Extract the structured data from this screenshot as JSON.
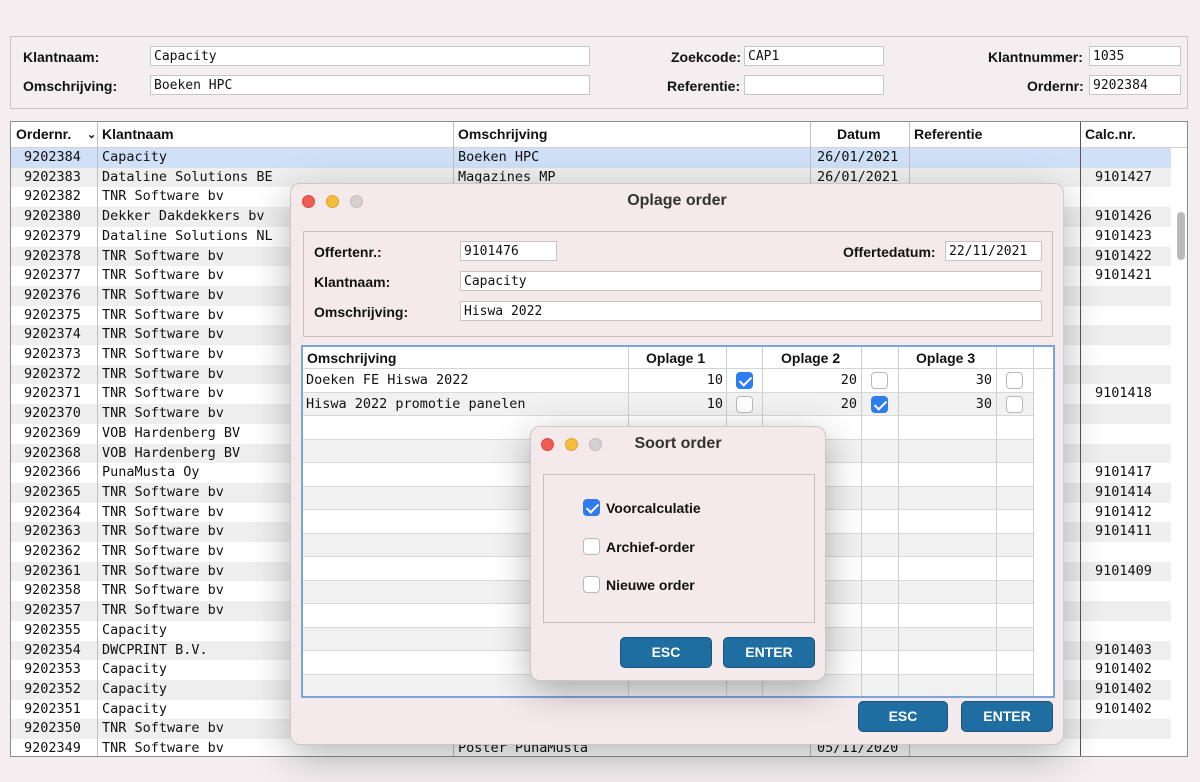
{
  "header": {
    "klantnaam_label": "Klantnaam:",
    "klantnaam_value": "Capacity",
    "omschrijving_label": "Omschrijving:",
    "omschrijving_value": "Boeken HPC",
    "zoekcode_label": "Zoekcode:",
    "zoekcode_value": "CAP1",
    "referentie_label": "Referentie:",
    "referentie_value": "",
    "klantnummer_label": "Klantnummer:",
    "klantnummer_value": "1035",
    "ordernr_label": "Ordernr:",
    "ordernr_value": "9202384"
  },
  "list": {
    "columns": [
      "Ordernr.",
      "Klantnaam",
      "Omschrijving",
      "Datum",
      "Referentie",
      "Calc.nr."
    ],
    "sort_icon": "chevron-down-icon",
    "rows": [
      [
        "9202384",
        "Capacity",
        "Boeken HPC",
        "26/01/2021",
        "",
        ""
      ],
      [
        "9202383",
        "Dataline Solutions BE",
        "Magazines MP",
        "26/01/2021",
        "",
        "9101427"
      ],
      [
        "9202382",
        "TNR Software bv",
        "",
        "",
        "",
        ""
      ],
      [
        "9202380",
        "Dekker Dakdekkers bv",
        "",
        "",
        "",
        "9101426"
      ],
      [
        "9202379",
        "Dataline Solutions NL",
        "",
        "",
        "",
        "9101423"
      ],
      [
        "9202378",
        "TNR Software bv",
        "",
        "",
        "",
        "9101422"
      ],
      [
        "9202377",
        "TNR Software bv",
        "",
        "",
        "",
        "9101421"
      ],
      [
        "9202376",
        "TNR Software bv",
        "",
        "",
        "",
        ""
      ],
      [
        "9202375",
        "TNR Software bv",
        "",
        "",
        "",
        ""
      ],
      [
        "9202374",
        "TNR Software bv",
        "",
        "",
        "",
        ""
      ],
      [
        "9202373",
        "TNR Software bv",
        "",
        "",
        "",
        ""
      ],
      [
        "9202372",
        "TNR Software bv",
        "",
        "",
        "",
        ""
      ],
      [
        "9202371",
        "TNR Software bv",
        "",
        "",
        "",
        "9101418"
      ],
      [
        "9202370",
        "TNR Software bv",
        "",
        "",
        "",
        ""
      ],
      [
        "9202369",
        "VOB Hardenberg BV",
        "",
        "",
        "",
        ""
      ],
      [
        "9202368",
        "VOB Hardenberg BV",
        "",
        "",
        "",
        ""
      ],
      [
        "9202366",
        "PunaMusta Oy",
        "",
        "",
        "",
        "9101417"
      ],
      [
        "9202365",
        "TNR Software bv",
        "",
        "",
        "",
        "9101414"
      ],
      [
        "9202364",
        "TNR Software bv",
        "",
        "",
        "",
        "9101412"
      ],
      [
        "9202363",
        "TNR Software bv",
        "",
        "",
        "",
        "9101411"
      ],
      [
        "9202362",
        "TNR Software bv",
        "",
        "",
        "",
        ""
      ],
      [
        "9202361",
        "TNR Software bv",
        "",
        "",
        "",
        "9101409"
      ],
      [
        "9202358",
        "TNR Software bv",
        "",
        "",
        "",
        ""
      ],
      [
        "9202357",
        "TNR Software bv",
        "",
        "",
        "",
        ""
      ],
      [
        "9202355",
        "Capacity",
        "",
        "",
        "",
        ""
      ],
      [
        "9202354",
        "DWCPRINT B.V.",
        "",
        "",
        "",
        "9101403"
      ],
      [
        "9202353",
        "Capacity",
        "",
        "",
        "",
        "9101402"
      ],
      [
        "9202352",
        "Capacity",
        "",
        "",
        "",
        "9101402"
      ],
      [
        "9202351",
        "Capacity",
        "",
        "",
        "",
        "9101402"
      ],
      [
        "9202350",
        "TNR Software bv",
        "",
        "",
        "",
        ""
      ],
      [
        "9202349",
        "TNR Software bv",
        "Poster PunaMusta",
        "05/11/2020",
        "",
        ""
      ]
    ]
  },
  "oplage": {
    "title": "Oplage order",
    "offertenr_label": "Offertenr.:",
    "offertenr_value": "9101476",
    "offertedatum_label": "Offertedatum:",
    "offertedatum_value": "22/11/2021",
    "klantnaam_label": "Klantnaam:",
    "klantnaam_value": "Capacity",
    "omschrijving_label": "Omschrijving:",
    "omschrijving_value": "Hiswa 2022",
    "columns": [
      "Omschrijving",
      "Oplage 1",
      "Oplage 2",
      "Oplage 3"
    ],
    "rows": [
      {
        "omschrijving": "Doeken FE Hiswa 2022",
        "oplage1": "10",
        "check1": true,
        "oplage2": "20",
        "check2": false,
        "oplage3": "30",
        "check3": false
      },
      {
        "omschrijving": "Hiswa 2022 promotie panelen",
        "oplage1": "10",
        "check1": false,
        "oplage2": "20",
        "check2": true,
        "oplage3": "30",
        "check3": false
      }
    ],
    "esc_label": "ESC",
    "enter_label": "ENTER"
  },
  "soort": {
    "title": "Soort order",
    "options": [
      {
        "label": "Voorcalculatie",
        "checked": true
      },
      {
        "label": "Archief-order",
        "checked": false
      },
      {
        "label": "Nieuwe order",
        "checked": false
      }
    ],
    "esc_label": "ESC",
    "enter_label": "ENTER"
  },
  "colors": {
    "selection": "#cfe0f7",
    "button": "#1f6ea1",
    "checkbox_on": "#2d7cf0",
    "dialog_bg": "#f5eaeb"
  }
}
